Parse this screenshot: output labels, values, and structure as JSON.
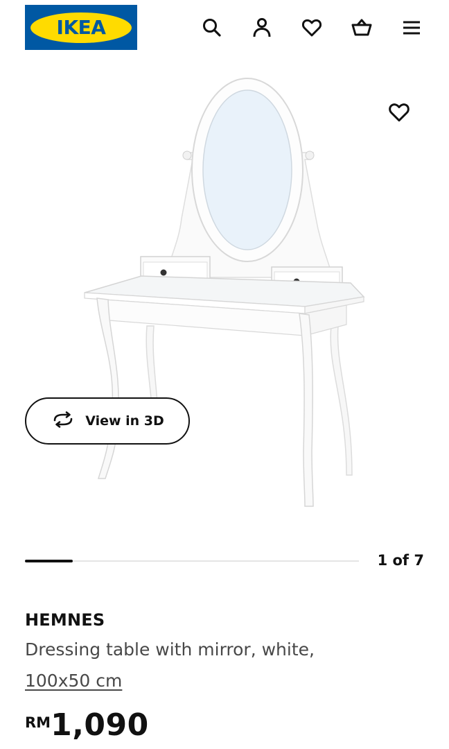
{
  "header": {
    "logo_text": "IKEA",
    "icons": [
      "search-icon",
      "account-icon",
      "favourites-icon",
      "basket-icon",
      "menu-icon"
    ]
  },
  "gallery": {
    "view_3d_label": "View in 3D",
    "pager_text": "1 of 7",
    "progress": 0.143
  },
  "product": {
    "name": "HEMNES",
    "description": "Dressing table with mirror, white,",
    "size": "100x50 cm",
    "currency": "RM",
    "price": "1,090"
  },
  "colors": {
    "brand_blue": "#0058a3",
    "brand_yellow": "#ffdb00",
    "text": "#111111",
    "muted_text": "#484848"
  }
}
